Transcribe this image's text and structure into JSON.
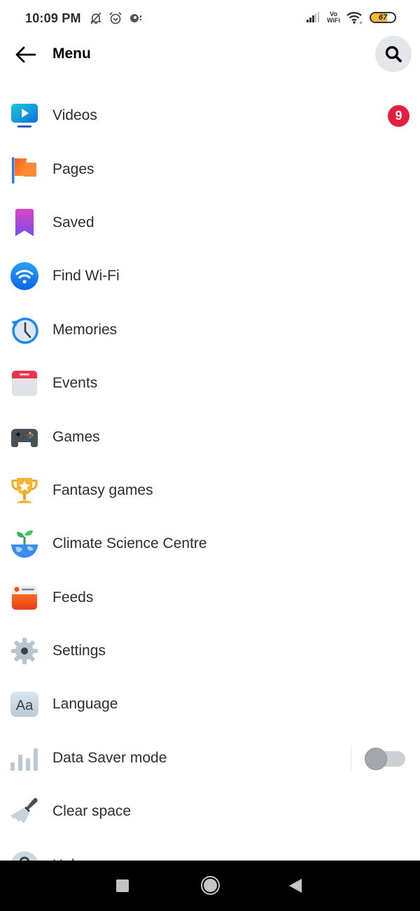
{
  "status_bar": {
    "time": "10:09 PM",
    "left_icons": [
      "notifications-off-icon",
      "alarm-icon",
      "app-notification-icon"
    ],
    "right_icons": [
      "signal-icon",
      "vowifi-icon",
      "wifi-icon",
      "battery-icon"
    ],
    "vowifi_line1": "Vo",
    "vowifi_line2": "WiFi",
    "battery_percent": 67,
    "battery_label": "67"
  },
  "header": {
    "title": "Menu",
    "back_icon": "arrow-left-icon",
    "search_icon": "search-icon"
  },
  "menu": {
    "items": [
      {
        "label": "Videos",
        "icon": "videos-icon",
        "badge": "9"
      },
      {
        "label": "Pages",
        "icon": "pages-flag-icon"
      },
      {
        "label": "Saved",
        "icon": "saved-bookmark-icon"
      },
      {
        "label": "Find Wi-Fi",
        "icon": "wifi-icon"
      },
      {
        "label": "Memories",
        "icon": "memories-clock-icon"
      },
      {
        "label": "Events",
        "icon": "events-calendar-icon"
      },
      {
        "label": "Games",
        "icon": "gamepad-icon"
      },
      {
        "label": "Fantasy games",
        "icon": "trophy-icon"
      },
      {
        "label": "Climate Science Centre",
        "icon": "globe-sprout-icon"
      },
      {
        "label": "Feeds",
        "icon": "feeds-icon"
      },
      {
        "label": "Settings",
        "icon": "gear-icon"
      },
      {
        "label": "Language",
        "icon": "language-icon"
      },
      {
        "label": "Data Saver mode",
        "icon": "data-bars-icon",
        "toggle": false
      },
      {
        "label": "Clear space",
        "icon": "broom-icon"
      },
      {
        "label": "Help",
        "icon": "help-icon"
      }
    ]
  },
  "nav_bar": {
    "recent_icon": "recent-apps-icon",
    "home_icon": "home-icon",
    "back_icon": "back-triangle-icon"
  },
  "colors": {
    "badge": "#e41e3f",
    "search_bg": "#e4e6eb",
    "battery_fill": "#f5b93b",
    "text": "#2b2d31"
  }
}
